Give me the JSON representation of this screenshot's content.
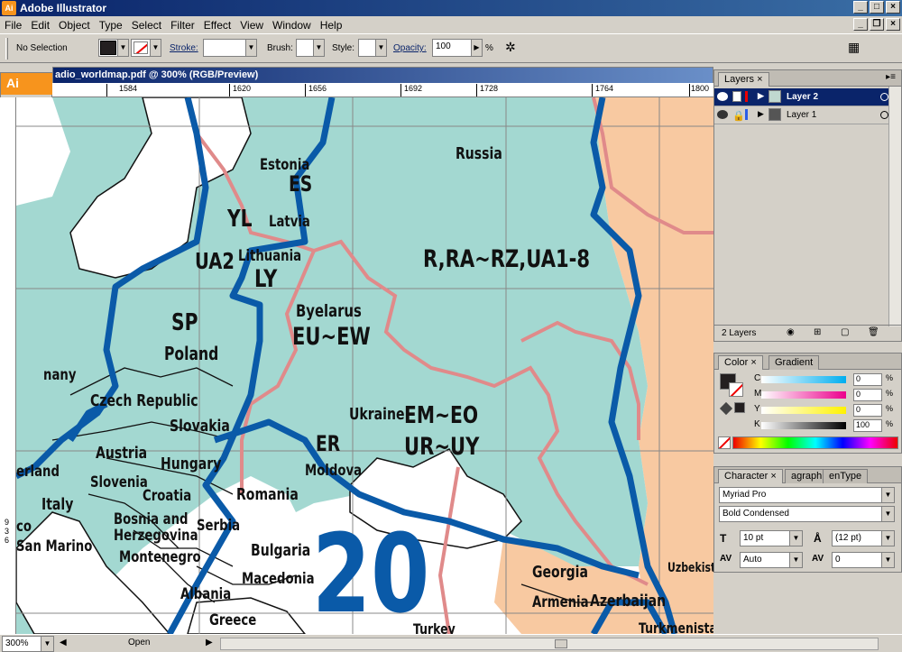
{
  "window": {
    "title": "Adobe Illustrator",
    "app_icon": "Ai"
  },
  "menu": {
    "items": [
      "File",
      "Edit",
      "Object",
      "Type",
      "Select",
      "Filter",
      "Effect",
      "View",
      "Window",
      "Help"
    ]
  },
  "control_bar": {
    "selection": "No Selection",
    "stroke_label": "Stroke:",
    "brush_label": "Brush:",
    "style_label": "Style:",
    "opacity_label": "Opacity:",
    "opacity_value": "100",
    "opacity_unit": "%"
  },
  "document": {
    "tab_title": "adio_worldmap.pdf @ 300% (RGB/Preview)",
    "ruler_labels": [
      "1584",
      "1620",
      "1656",
      "1692",
      "1728",
      "1764",
      "1800"
    ],
    "left_ruler_digits": [
      "9",
      "3",
      "6"
    ]
  },
  "toolbox": {
    "logo": "Ai"
  },
  "map": {
    "labels": {
      "russia": "Russia",
      "estonia": "Estonia",
      "es": "ES",
      "yl": "YL",
      "latvia": "Latvia",
      "lithuania": "Lithuania",
      "ua2": "UA2",
      "ly": "LY",
      "r_prefix": "R,RA~RZ,UA1-8",
      "sp": "SP",
      "poland": "Poland",
      "byelarus": "Byelarus",
      "eu_ew": "EU~EW",
      "germany": "nany",
      "czech": "Czech Republic",
      "slovakia": "Slovakia",
      "ukraine": "Ukraine",
      "em_eo": "EM~EO",
      "ur_uy": "UR~UY",
      "austria": "Austria",
      "hungary": "Hungary",
      "er": "ER",
      "moldova": "Moldova",
      "switzerland": "erland",
      "slovenia": "Slovenia",
      "croatia": "Croatia",
      "romania": "Romania",
      "italy": "Italy",
      "bosnia": "Bosnia and",
      "herzegovina": "Herzegovina",
      "serbia": "Serbia",
      "sanmarino": "San Marino",
      "montenegro": "Montenegro",
      "bulgaria": "Bulgaria",
      "macedonia": "Macedonia",
      "albania": "Albania",
      "greece": "Greece",
      "georgia": "Georgia",
      "armenia": "Armenia",
      "azerbaijan": "Azerbaijan",
      "turkey": "Turkey",
      "turkmenistan": "Turkmenistan",
      "uzbekistan": "Uzbekistan",
      "zone": "20",
      "co": "co"
    }
  },
  "layers_panel": {
    "tab": "Layers",
    "layers": [
      {
        "name": "Layer 2",
        "selected": true
      },
      {
        "name": "Layer 1",
        "selected": false
      }
    ],
    "count": "2 Layers"
  },
  "color_panel": {
    "tabs": [
      "Color",
      "Gradient"
    ],
    "channels": [
      {
        "label": "C",
        "value": "0"
      },
      {
        "label": "M",
        "value": "0"
      },
      {
        "label": "Y",
        "value": "0"
      },
      {
        "label": "K",
        "value": "100"
      }
    ],
    "unit": "%"
  },
  "character_panel": {
    "tabs": [
      "Character",
      "agraph",
      "enType"
    ],
    "font_family": "Myriad Pro",
    "font_style": "Bold Condensed",
    "font_size": "10 pt",
    "leading": "(12 pt)",
    "kerning": "Auto",
    "tracking": "0"
  },
  "status_bar": {
    "zoom": "300%",
    "status": "Open"
  },
  "colors": {
    "land_teal": "#a3d8d1",
    "land_peach": "#f8c9a1",
    "zone_blue": "#0a5aa8",
    "border_pink": "#e08a8a",
    "ruler_grid": "#888888"
  }
}
